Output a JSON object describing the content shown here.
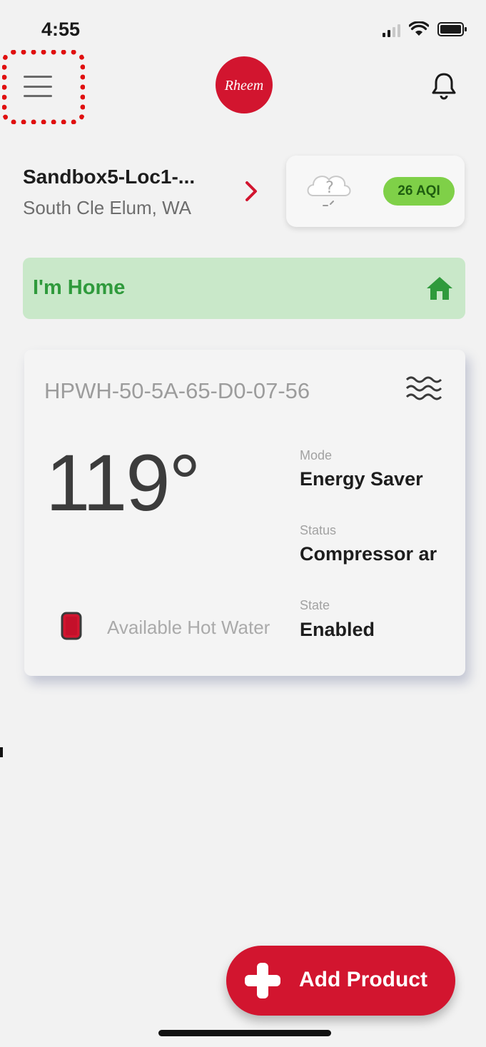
{
  "status_bar": {
    "time": "4:55",
    "icons": [
      "signal-icon",
      "wifi-icon",
      "battery-icon"
    ]
  },
  "header": {
    "menu_icon": "hamburger-menu-icon",
    "logo_text": "Rheem",
    "bell_icon": "bell-icon",
    "highlight_color": "#e01010"
  },
  "location": {
    "name": "Sandbox5-Loc1-...",
    "city": "South Cle Elum, WA",
    "chevron_icon": "chevron-right-icon"
  },
  "weather": {
    "icon": "cloud-question-icon",
    "aqi": "26 AQI",
    "aqi_color": "#7fd048"
  },
  "presence": {
    "label": "I'm Home",
    "icon": "home-icon",
    "color": "#2f9a3c"
  },
  "device": {
    "name": "HPWH-50-5A-65-D0-07-56",
    "type_icon": "water-waves-icon",
    "temperature": "119°",
    "mode_label": "Mode",
    "mode_value": "Energy Saver",
    "status_label": "Status",
    "status_value": "Compressor ar",
    "state_label": "State",
    "state_value": "Enabled",
    "hot_water_label": "Available Hot Water",
    "hot_water_icon": "tank-level-icon"
  },
  "actions": {
    "add_product_label": "Add Product",
    "add_icon": "plus-icon",
    "accent": "#d2152f"
  }
}
